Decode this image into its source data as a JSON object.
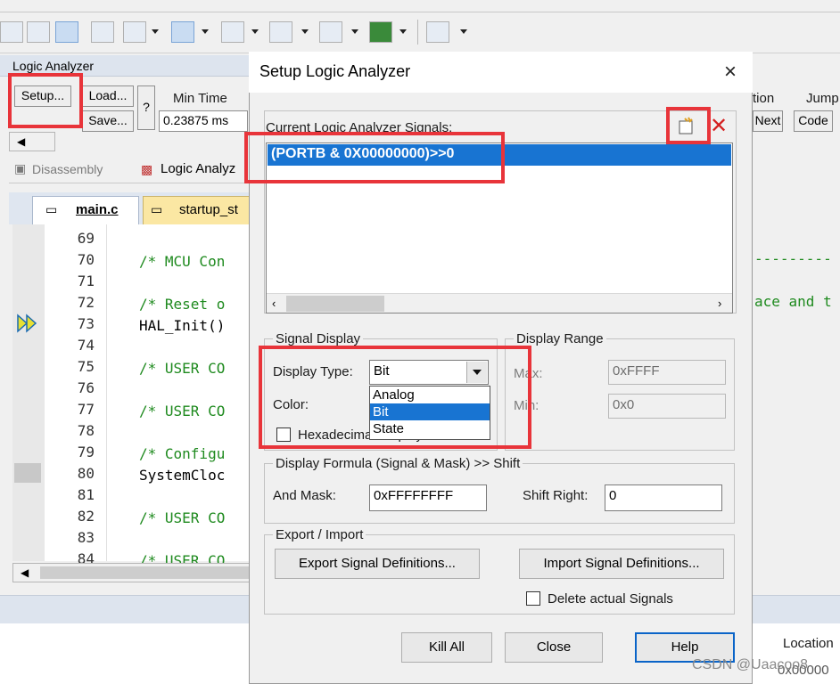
{
  "colors": {
    "accent": "#1874d2",
    "highlight": "#e8343a",
    "comment": "#1e8a1e"
  },
  "logic_analyzer": {
    "title": "Logic Analyzer",
    "setup_label": "Setup...",
    "load_label": "Load...",
    "save_label": "Save...",
    "help_label": "?",
    "min_time_label": "Min Time",
    "min_time_value": "0.23875 ms"
  },
  "right_panel": {
    "col1_header": "tion",
    "col2_header": "Jump",
    "next_label": "Next",
    "code_label": "Code"
  },
  "tabs": [
    {
      "label": "Disassembly"
    },
    {
      "label": "Logic Analyz"
    }
  ],
  "doc_tabs": [
    {
      "label": "main.c"
    },
    {
      "label": "startup_st"
    }
  ],
  "code": {
    "lines": [
      {
        "no": "69",
        "text": ""
      },
      {
        "no": "70",
        "text": "/* MCU Con"
      },
      {
        "no": "71",
        "text": ""
      },
      {
        "no": "72",
        "text": "/* Reset o"
      },
      {
        "no": "73",
        "text": "HAL_Init()"
      },
      {
        "no": "74",
        "text": ""
      },
      {
        "no": "75",
        "text": "/* USER CO"
      },
      {
        "no": "76",
        "text": ""
      },
      {
        "no": "77",
        "text": "/* USER CO"
      },
      {
        "no": "78",
        "text": ""
      },
      {
        "no": "79",
        "text": "/* Configu"
      },
      {
        "no": "80",
        "text": "SystemCloc"
      },
      {
        "no": "81",
        "text": ""
      },
      {
        "no": "82",
        "text": "/* USER CO"
      },
      {
        "no": "83",
        "text": ""
      },
      {
        "no": "84",
        "text": "/* USER CO"
      }
    ],
    "right_fragments": {
      "dashes": "---------",
      "ace": "ace and t"
    }
  },
  "bottom": {
    "location_label": "Location",
    "location_value": "0x00000"
  },
  "watermark": "CSDN @Uaacoo8",
  "dialog": {
    "title": "Setup Logic Analyzer",
    "close_label": "×",
    "signals_label": "Current Logic Analyzer Signals:",
    "signals": [
      "(PORTB & 0X00000000)>>0"
    ],
    "signal_display": {
      "label": "Signal Display",
      "display_type_label": "Display Type:",
      "display_type_value": "Bit",
      "options": [
        "Analog",
        "Bit",
        "State"
      ],
      "selected_option": "Bit",
      "color_label": "Color:",
      "hex_label": "Hexadecimal Display"
    },
    "display_range": {
      "label": "Display Range",
      "max_label": "Max:",
      "max_value": "0xFFFF",
      "min_label": "Min:",
      "min_value": "0x0"
    },
    "formula": {
      "label": "Display Formula (Signal & Mask) >> Shift",
      "and_mask_label": "And Mask:",
      "and_mask_value": "0xFFFFFFFF",
      "shift_right_label": "Shift Right:",
      "shift_right_value": "0"
    },
    "export_import": {
      "label": "Export / Import",
      "export_label": "Export Signal Definitions...",
      "import_label": "Import Signal Definitions...",
      "delete_label": "Delete actual Signals"
    },
    "buttons": {
      "kill_all": "Kill All",
      "close": "Close",
      "help": "Help"
    }
  }
}
